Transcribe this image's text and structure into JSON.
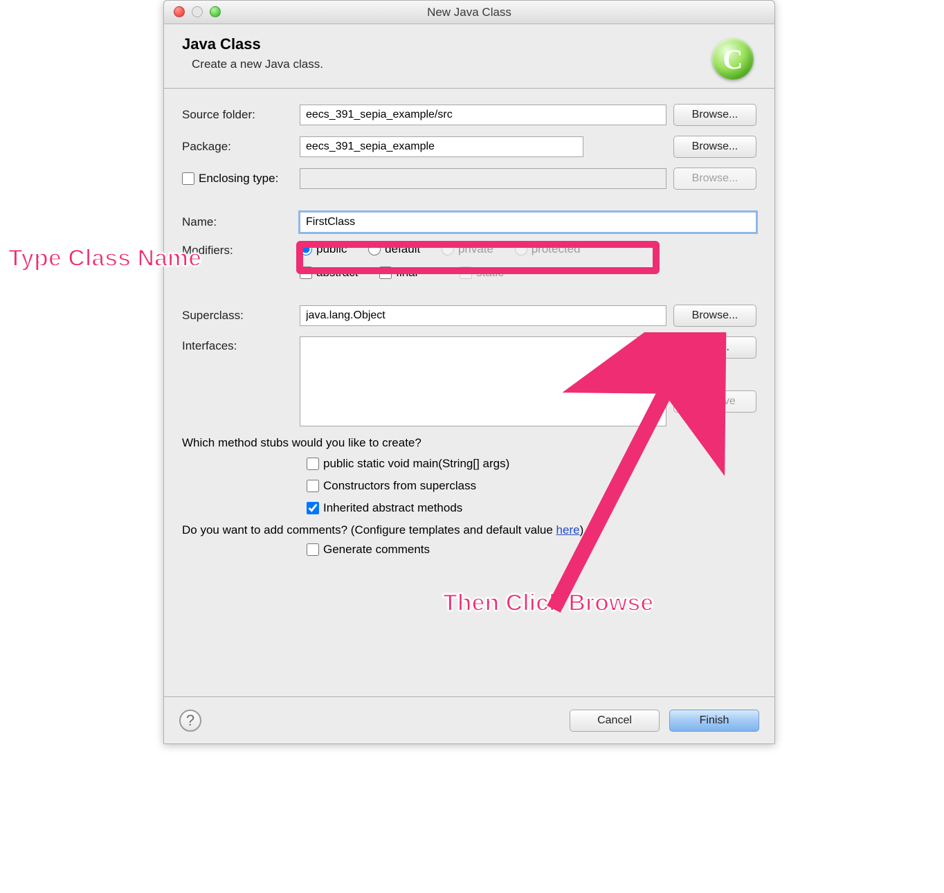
{
  "window_title": "New Java Class",
  "header": {
    "title": "Java Class",
    "subtitle": "Create a new Java class.",
    "icon_letter": "C"
  },
  "labels": {
    "source_folder": "Source folder:",
    "package": "Package:",
    "enclosing_type": "Enclosing type:",
    "name": "Name:",
    "modifiers": "Modifiers:",
    "superclass": "Superclass:",
    "interfaces": "Interfaces:"
  },
  "values": {
    "source_folder": "eecs_391_sepia_example/src",
    "package": "eecs_391_sepia_example",
    "enclosing_type": "",
    "name": "FirstClass",
    "superclass": "java.lang.Object"
  },
  "modifiers": {
    "public": "public",
    "default": "default",
    "private": "private",
    "protected": "protected",
    "abstract": "abstract",
    "final": "final",
    "static": "static"
  },
  "stubs": {
    "question": "Which method stubs would you like to create?",
    "main": "public static void main(String[] args)",
    "constructors": "Constructors from superclass",
    "inherited": "Inherited abstract methods"
  },
  "comments": {
    "question_prefix": "Do you want to add comments? (Configure templates and default value ",
    "link": "here",
    "question_suffix": ")",
    "generate": "Generate comments"
  },
  "buttons": {
    "browse": "Browse...",
    "add": "Add...",
    "remove": "Remove",
    "cancel": "Cancel",
    "finish": "Finish"
  },
  "annotations": {
    "type_name": "Type Class Name",
    "click_browse": "Then Click Browse"
  }
}
